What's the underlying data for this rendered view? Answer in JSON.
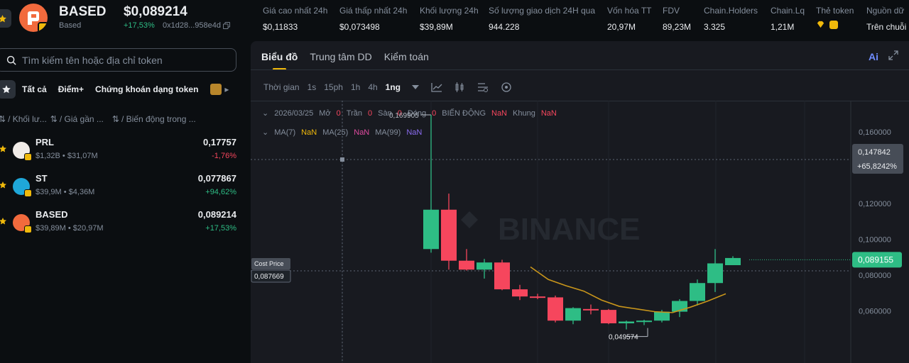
{
  "header": {
    "token_name": "BASED",
    "token_sub": "Based",
    "price": "$0,089214",
    "change": "+17,53%",
    "address": "0x1d28...958e4d",
    "stats": [
      {
        "label": "Giá cao nhất 24h",
        "value": "$0,11833"
      },
      {
        "label": "Giá thấp nhất 24h",
        "value": "$0,073498"
      },
      {
        "label": "Khối lượng 24h",
        "value": "$39,89M"
      },
      {
        "label": "Số lượng giao dịch 24H qua",
        "value": "944.228"
      },
      {
        "label": "Vốn hóa TT",
        "value": "20,97M"
      },
      {
        "label": "FDV",
        "value": "89,23M"
      },
      {
        "label": "Chain.Holders",
        "value": "3.325"
      },
      {
        "label": "Chain.Lq",
        "value": "1,21M"
      },
      {
        "label": "Thẻ token",
        "value": ""
      },
      {
        "label": "Nguồn dữ",
        "value": "Trên chuỗi"
      }
    ]
  },
  "sidebar": {
    "search_placeholder": "Tìm kiếm tên hoặc địa chỉ token",
    "filters": [
      "Tất cả",
      "Điểm+",
      "Chứng khoán dạng token"
    ],
    "columns": [
      "/ Khối lư...",
      "/ Giá gần ...",
      "/ Biến động trong ..."
    ],
    "tokens": [
      {
        "symbol": "PRL",
        "meta": "$1,32B • $31,07M",
        "price": "0,17757",
        "change": "-1,76%",
        "direction": "down",
        "color": "#f1ece8"
      },
      {
        "symbol": "ST",
        "meta": "$39,9M • $4,36M",
        "price": "0,077867",
        "change": "+94,62%",
        "direction": "up",
        "color": "#1fa7d9"
      },
      {
        "symbol": "BASED",
        "meta": "$39,89M • $20,97M",
        "price": "0,089214",
        "change": "+17,53%",
        "direction": "up",
        "color": "#f26a3d"
      }
    ]
  },
  "panel": {
    "tabs": [
      "Biểu đồ",
      "Trung tâm DD",
      "Kiểm toán"
    ],
    "ai_label": "Ai",
    "timeframe_label": "Thời gian",
    "timeframes": [
      "1s",
      "15ph",
      "1h",
      "4h",
      "1ng"
    ],
    "active_timeframe": "1ng"
  },
  "chart_data": {
    "type": "candlestick",
    "info_line": {
      "date": "2026/03/25",
      "open_label": "Mở",
      "open": "0",
      "high_label": "Trần",
      "high": "0",
      "low_label": "Sàn",
      "low": "0",
      "close_label": "Đóng",
      "close": "0",
      "change_label": "BIẾN ĐỘNG",
      "change": "NaN",
      "range_label": "Khung",
      "range": "NaN"
    },
    "ma_line": [
      {
        "label": "MA(7)",
        "value": "NaN",
        "color": "#f0b90b"
      },
      {
        "label": "MA(25)",
        "value": "NaN",
        "color": "#e04ba0"
      },
      {
        "label": "MA(99)",
        "value": "NaN",
        "color": "#8b6cf2"
      }
    ],
    "y_ticks": [
      0.16,
      0.12,
      0.1,
      0.08,
      0.06
    ],
    "y_tick_labels": [
      "0,160000",
      "0,120000",
      "0,100000",
      "0,080000",
      "0,060000"
    ],
    "ylim": [
      0.0435,
      0.1695
    ],
    "candles": [
      {
        "o": 0.0945,
        "h": 0.1695,
        "l": 0.0925,
        "c": 0.1165
      },
      {
        "o": 0.1165,
        "h": 0.1255,
        "l": 0.083,
        "c": 0.088
      },
      {
        "o": 0.088,
        "h": 0.0945,
        "l": 0.0825,
        "c": 0.083
      },
      {
        "o": 0.083,
        "h": 0.089,
        "l": 0.078,
        "c": 0.087
      },
      {
        "o": 0.087,
        "h": 0.0885,
        "l": 0.0715,
        "c": 0.072
      },
      {
        "o": 0.072,
        "h": 0.0745,
        "l": 0.066,
        "c": 0.068
      },
      {
        "o": 0.068,
        "h": 0.0695,
        "l": 0.0665,
        "c": 0.0675
      },
      {
        "o": 0.0675,
        "h": 0.0685,
        "l": 0.0535,
        "c": 0.0545
      },
      {
        "o": 0.0545,
        "h": 0.062,
        "l": 0.0525,
        "c": 0.0615
      },
      {
        "o": 0.061,
        "h": 0.0635,
        "l": 0.058,
        "c": 0.0605
      },
      {
        "o": 0.0605,
        "h": 0.061,
        "l": 0.0525,
        "c": 0.053
      },
      {
        "o": 0.053,
        "h": 0.0545,
        "l": 0.0496,
        "c": 0.054
      },
      {
        "o": 0.054,
        "h": 0.055,
        "l": 0.052,
        "c": 0.0545
      },
      {
        "o": 0.0545,
        "h": 0.0605,
        "l": 0.0535,
        "c": 0.0595
      },
      {
        "o": 0.0595,
        "h": 0.0665,
        "l": 0.0565,
        "c": 0.0655
      },
      {
        "o": 0.0655,
        "h": 0.0775,
        "l": 0.063,
        "c": 0.0755
      },
      {
        "o": 0.0755,
        "h": 0.0945,
        "l": 0.0705,
        "c": 0.0865
      },
      {
        "o": 0.0855,
        "h": 0.0905,
        "l": 0.0855,
        "c": 0.0895
      }
    ],
    "ma_series": [
      0.0845,
      0.0775,
      0.074,
      0.071,
      0.066,
      0.0625,
      0.061,
      0.0595,
      0.059,
      0.062,
      0.0655,
      0.0695
    ],
    "annotations": {
      "high_label": "0,169905",
      "low_label": "0,049574",
      "cost_price_title": "Cost Price",
      "cost_price_value": "0,087669",
      "crosshair_price": "0,147842",
      "crosshair_change": "+65,8242%",
      "last_price": "0,089155",
      "watermark": "BINANCE"
    },
    "colors": {
      "up": "#2ebd85",
      "down": "#f6465d",
      "ma": "#c9961b",
      "last_bg": "#2ebd85",
      "crosshair_bg": "#474d57"
    }
  }
}
